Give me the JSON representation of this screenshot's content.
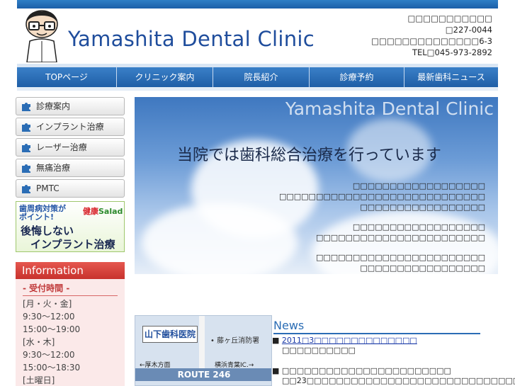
{
  "header": {
    "logo": "Yamashita Dental Clinic",
    "contact": [
      "□□□□□□□□□□□",
      "□227-0044",
      "□□□□□□□□□□□□□□6-3",
      "TEL□045-973-2892"
    ]
  },
  "nav": [
    "TOPページ",
    "クリニック案内",
    "院長紹介",
    "診療予約",
    "最新歯科ニュース"
  ],
  "sidebar": {
    "items": [
      "診療案内",
      "インプラント治療",
      "レーザー治療",
      "無痛治療",
      "PMTC"
    ],
    "banner": {
      "line1a": "歯周病対策が",
      "line1b": "ポイント!",
      "salad_a": "健康",
      "salad_b": "Salad",
      "line2a": "後悔しない",
      "line2b": "インプラント治療"
    }
  },
  "info": {
    "heading": "Information",
    "title": "- 受付時間 -",
    "rows": [
      "[月・火・金]",
      "9:30〜12:00",
      "15:00〜19:00",
      "[水・木]",
      "9:30〜12:00",
      "15:00〜18:30",
      "[土曜日]"
    ]
  },
  "hero": {
    "brand": "Yamashita Dental Clinic",
    "title": "当院では歯科総合治療を行っています",
    "p1": [
      "□□□□□□□□□□□□□□□□□□",
      "□□□□□□□□□□□□□□□□□□□□□□□□□□□□",
      "□□□□□□□□□□□□□□□□□"
    ],
    "p2": [
      "□□□□□□□□□□□□□□□□□□",
      "□□□□□□□□□□□□□□□□□□□□□□□"
    ],
    "p3": [
      "□□□□□□□□□□□□□□□□□□□□□□□",
      "□□□□□□□□□□□□□□□□□"
    ]
  },
  "map": {
    "clinic": "山下歯科医院",
    "station": "藤ヶ丘消防署",
    "left": "←厚木方面",
    "right": "横浜青葉IC.→",
    "route": "ROUTE 246"
  },
  "news": {
    "heading": "News",
    "items": [
      {
        "link": "2011□3□□□□□□□□□□□□□□",
        "sub": "□□□□□□□□□□"
      },
      {
        "text": "□□□□□□□□□□□□□□□□□□□□□□□",
        "sub": "□□23□□□□□□□□□□□□□□□□□□□□□□□□□□□□□□□□□□□"
      }
    ]
  },
  "colors": {
    "brand_blue": "#2b6db5",
    "info_red": "#c8322d"
  }
}
